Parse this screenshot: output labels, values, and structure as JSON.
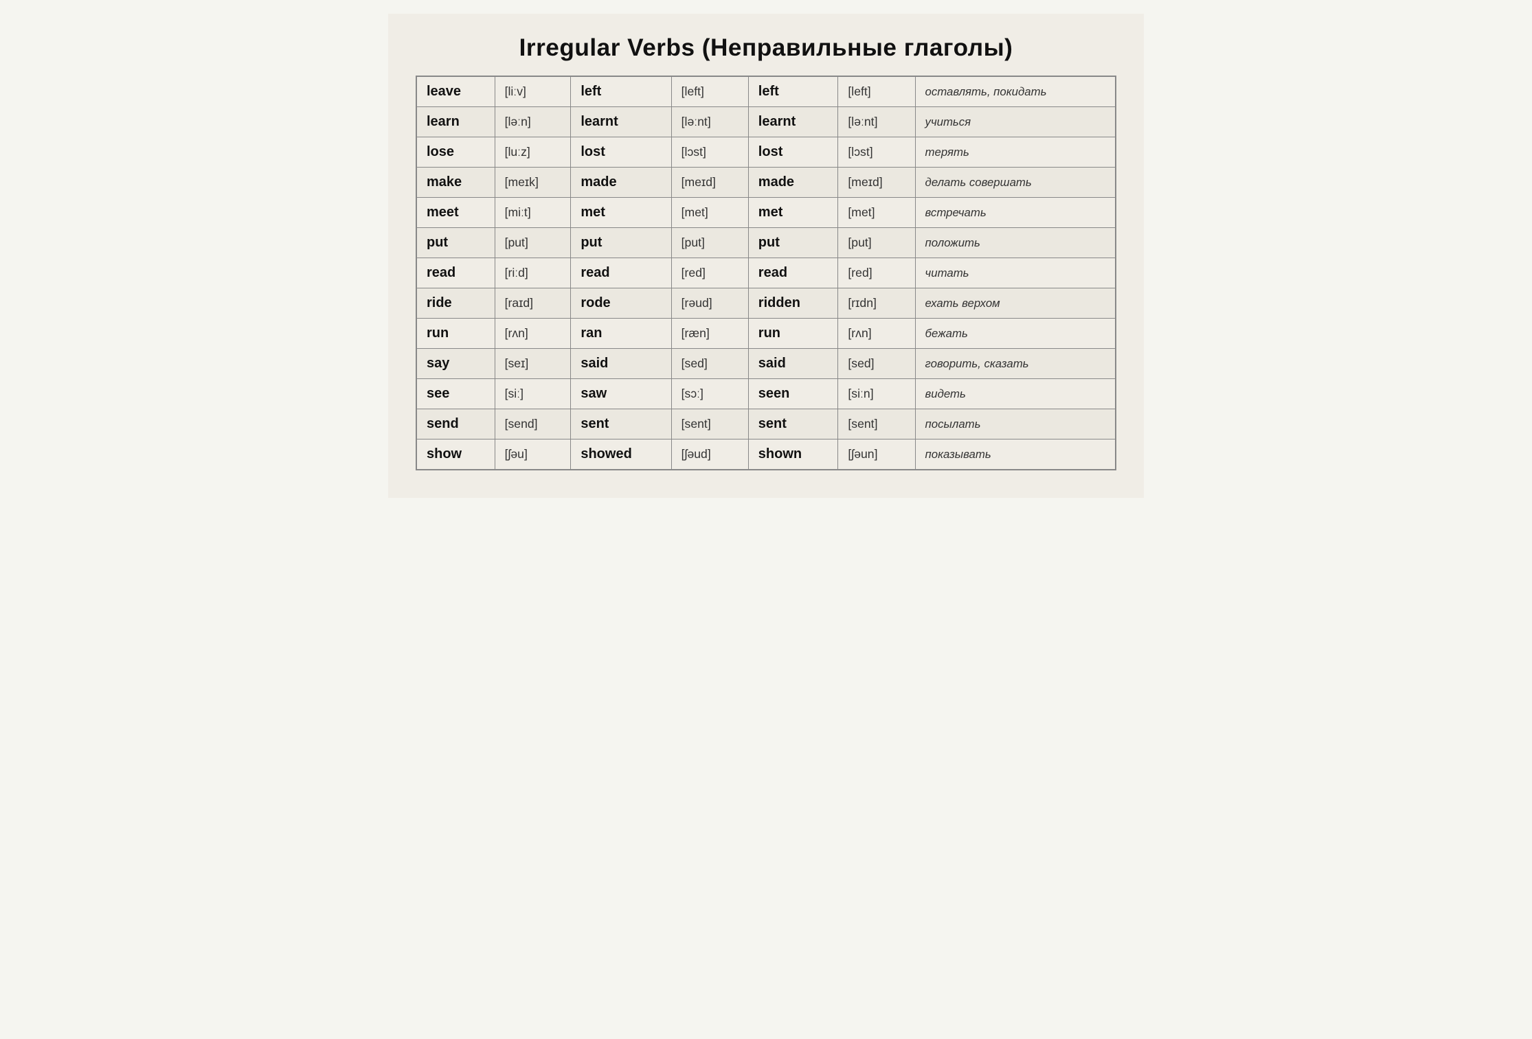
{
  "title": "Irregular Verbs (Неправильные глаголы)",
  "columns": [
    "base",
    "base_ph",
    "past_simple",
    "past_simple_ph",
    "past_participle",
    "past_participle_ph",
    "translation"
  ],
  "rows": [
    {
      "base": "leave",
      "base_ph": "[liːv]",
      "past_simple": "left",
      "past_simple_ph": "[left]",
      "past_participle": "left",
      "past_participle_ph": "[left]",
      "translation": "оставлять, покидать"
    },
    {
      "base": "learn",
      "base_ph": "[ləːn]",
      "past_simple": "learnt",
      "past_simple_ph": "[ləːnt]",
      "past_participle": "learnt",
      "past_participle_ph": "[ləːnt]",
      "translation": "учиться"
    },
    {
      "base": "lose",
      "base_ph": "[luːz]",
      "past_simple": "lost",
      "past_simple_ph": "[lɔst]",
      "past_participle": "lost",
      "past_participle_ph": "[lɔst]",
      "translation": "терять"
    },
    {
      "base": "make",
      "base_ph": "[meɪk]",
      "past_simple": "made",
      "past_simple_ph": "[meɪd]",
      "past_participle": "made",
      "past_participle_ph": "[meɪd]",
      "translation": "делать совершать"
    },
    {
      "base": "meet",
      "base_ph": "[miːt]",
      "past_simple": "met",
      "past_simple_ph": "[met]",
      "past_participle": "met",
      "past_participle_ph": "[met]",
      "translation": "встречать"
    },
    {
      "base": "put",
      "base_ph": "[put]",
      "past_simple": "put",
      "past_simple_ph": "[put]",
      "past_participle": "put",
      "past_participle_ph": "[put]",
      "translation": "положить"
    },
    {
      "base": "read",
      "base_ph": "[riːd]",
      "past_simple": "read",
      "past_simple_ph": "[red]",
      "past_participle": "read",
      "past_participle_ph": "[red]",
      "translation": "читать"
    },
    {
      "base": "ride",
      "base_ph": "[raɪd]",
      "past_simple": "rode",
      "past_simple_ph": "[rəud]",
      "past_participle": "ridden",
      "past_participle_ph": "[rɪdn]",
      "translation": "ехать верхом"
    },
    {
      "base": "run",
      "base_ph": "[rʌn]",
      "past_simple": "ran",
      "past_simple_ph": "[ræn]",
      "past_participle": "run",
      "past_participle_ph": "[rʌn]",
      "translation": "бежать"
    },
    {
      "base": "say",
      "base_ph": "[seɪ]",
      "past_simple": "said",
      "past_simple_ph": "[sed]",
      "past_participle": "said",
      "past_participle_ph": "[sed]",
      "translation": "говорить, сказать"
    },
    {
      "base": "see",
      "base_ph": "[siː]",
      "past_simple": "saw",
      "past_simple_ph": "[sɔː]",
      "past_participle": "seen",
      "past_participle_ph": "[siːn]",
      "translation": "видеть"
    },
    {
      "base": "send",
      "base_ph": "[send]",
      "past_simple": "sent",
      "past_simple_ph": "[sent]",
      "past_participle": "sent",
      "past_participle_ph": "[sent]",
      "translation": "посылать"
    },
    {
      "base": "show",
      "base_ph": "[ʃəu]",
      "past_simple": "showed",
      "past_simple_ph": "[ʃəud]",
      "past_participle": "shown",
      "past_participle_ph": "[ʃəun]",
      "translation": "показывать"
    }
  ]
}
